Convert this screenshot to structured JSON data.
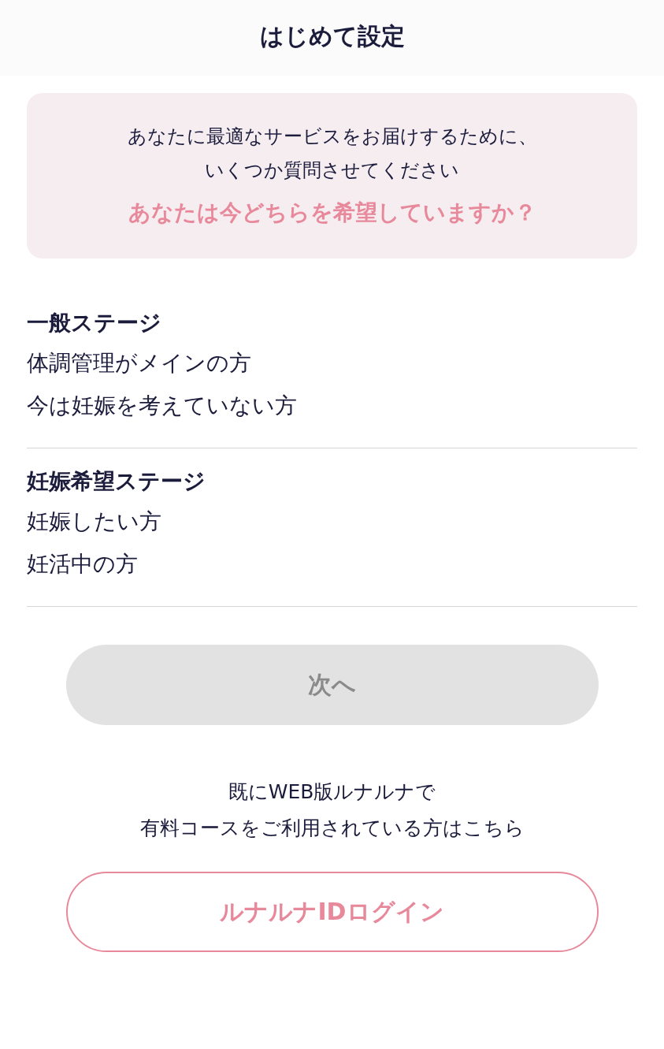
{
  "header": {
    "title": "はじめて設定"
  },
  "intro": {
    "lines": [
      "あなたに最適なサービスをお届けするために、",
      "いくつか質問させてください"
    ],
    "question": "あなたは今どちらを希望していますか？"
  },
  "options": [
    {
      "title": "一般ステージ",
      "lines": [
        "体調管理がメインの方",
        "今は妊娠を考えていない方"
      ],
      "selected": false
    },
    {
      "title": "妊娠希望ステージ",
      "lines": [
        "妊娠したい方",
        "妊活中の方"
      ],
      "selected": false
    }
  ],
  "next_button": {
    "label": "次へ",
    "disabled": true
  },
  "login_note": {
    "lines": [
      "既にWEB版ルナルナで",
      "有料コースをご利用されている方はこちら"
    ]
  },
  "login_button": {
    "label": "ルナルナIDログイン"
  }
}
